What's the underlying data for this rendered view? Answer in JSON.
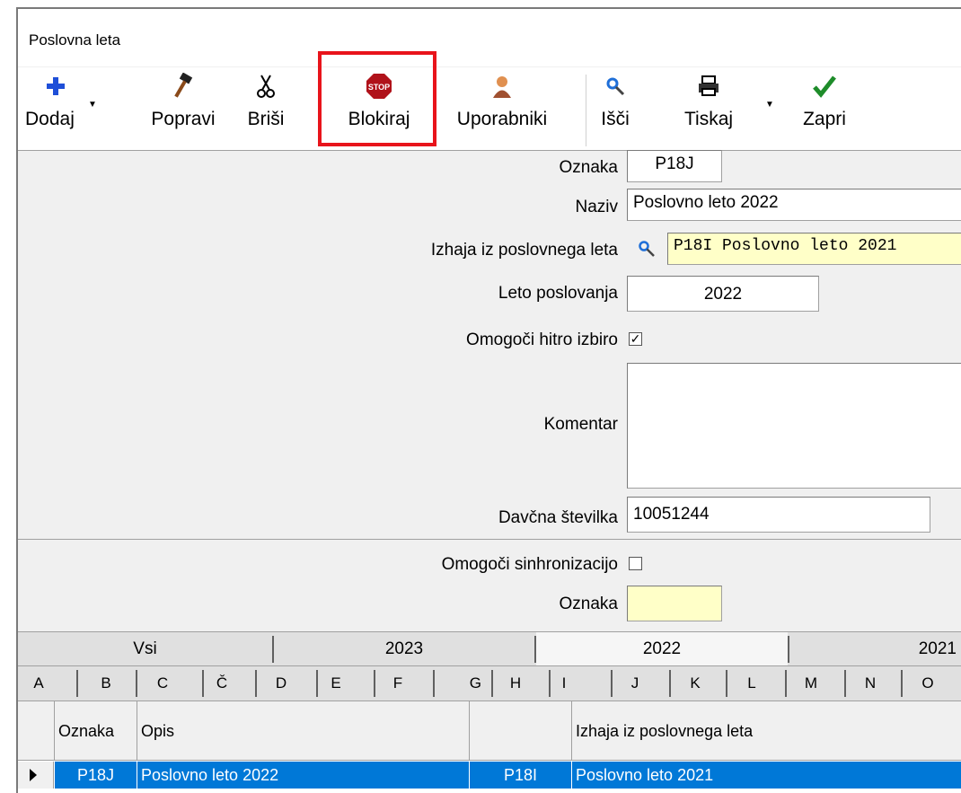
{
  "window": {
    "title": "Poslovna leta"
  },
  "toolbar": {
    "dodaj": "Dodaj",
    "popravi": "Popravi",
    "brisi": "Briši",
    "blokiraj": "Blokiraj",
    "uporabniki": "Uporabniki",
    "isci": "Išči",
    "tiskaj": "Tiskaj",
    "zapri": "Zapri",
    "stop_glyph": "STOP"
  },
  "form": {
    "oznaka_label": "Oznaka",
    "oznaka_value": "P18J",
    "naziv_label": "Naziv",
    "naziv_value": "Poslovno leto 2022",
    "izhaja_label": "Izhaja iz poslovnega leta",
    "izhaja_value": "P18I Poslovno leto 2021",
    "leto_label": "Leto poslovanja",
    "leto_value": "2022",
    "hitro_label": "Omogoči hitro izbiro",
    "hitro_checked": "✓",
    "komentar_label": "Komentar",
    "komentar_value": "",
    "davcna_label": "Davčna številka",
    "davcna_value": "10051244",
    "sinh_label": "Omogoči sinhronizacijo",
    "sinh_oznaka_label": "Oznaka",
    "sinh_oznaka_value": ""
  },
  "year_tabs": [
    "Vsi",
    "2023",
    "2022",
    "2021"
  ],
  "letter_tabs": [
    "A",
    "B",
    "C",
    "Č",
    "D",
    "E",
    "F",
    "G",
    "H",
    "I",
    "J",
    "K",
    "L",
    "M",
    "N",
    "O"
  ],
  "grid": {
    "headers": [
      "Oznaka",
      "Opis",
      "",
      "Izhaja iz poslovnega leta"
    ],
    "rows": [
      [
        "P18J",
        "Poslovno leto 2022",
        "P18I",
        "Poslovno leto 2021"
      ]
    ]
  },
  "colors": {
    "accent": "#0078d7",
    "highlight": "#e8141b",
    "field_yellow": "#ffffc8"
  }
}
